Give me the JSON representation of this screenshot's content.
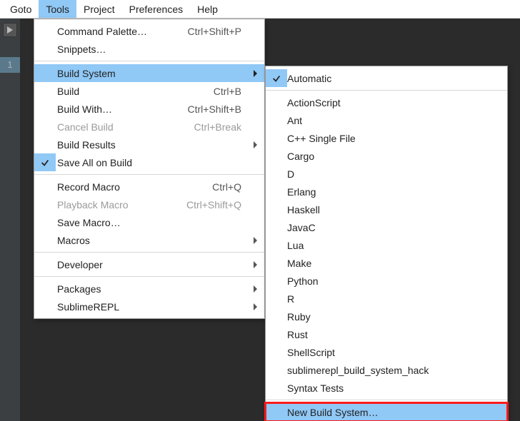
{
  "menubar": {
    "items": [
      "Goto",
      "Tools",
      "Project",
      "Preferences",
      "Help"
    ],
    "open_index": 1
  },
  "line_number": "1",
  "tools_menu": {
    "groups": [
      [
        {
          "label": "Command Palette…",
          "accel": "Ctrl+Shift+P"
        },
        {
          "label": "Snippets…"
        }
      ],
      [
        {
          "label": "Build System",
          "submenu": true,
          "highlight": true
        },
        {
          "label": "Build",
          "accel": "Ctrl+B"
        },
        {
          "label": "Build With…",
          "accel": "Ctrl+Shift+B"
        },
        {
          "label": "Cancel Build",
          "accel": "Ctrl+Break",
          "disabled": true
        },
        {
          "label": "Build Results",
          "submenu": true
        },
        {
          "label": "Save All on Build",
          "checked": true
        }
      ],
      [
        {
          "label": "Record Macro",
          "accel": "Ctrl+Q"
        },
        {
          "label": "Playback Macro",
          "accel": "Ctrl+Shift+Q",
          "disabled": true
        },
        {
          "label": "Save Macro…"
        },
        {
          "label": "Macros",
          "submenu": true
        }
      ],
      [
        {
          "label": "Developer",
          "submenu": true
        }
      ],
      [
        {
          "label": "Packages",
          "submenu": true
        },
        {
          "label": "SublimeREPL",
          "submenu": true
        }
      ]
    ]
  },
  "build_submenu": {
    "groups": [
      [
        {
          "label": "Automatic",
          "checked": true
        }
      ],
      [
        {
          "label": "ActionScript"
        },
        {
          "label": "Ant"
        },
        {
          "label": "C++ Single File"
        },
        {
          "label": "Cargo"
        },
        {
          "label": "D"
        },
        {
          "label": "Erlang"
        },
        {
          "label": "Haskell"
        },
        {
          "label": "JavaC"
        },
        {
          "label": "Lua"
        },
        {
          "label": "Make"
        },
        {
          "label": "Python"
        },
        {
          "label": "R"
        },
        {
          "label": "Ruby"
        },
        {
          "label": "Rust"
        },
        {
          "label": "ShellScript"
        },
        {
          "label": "sublimerepl_build_system_hack"
        },
        {
          "label": "Syntax Tests"
        }
      ],
      [
        {
          "label": "New Build System…",
          "highlight": true,
          "redbox": true
        }
      ]
    ]
  }
}
